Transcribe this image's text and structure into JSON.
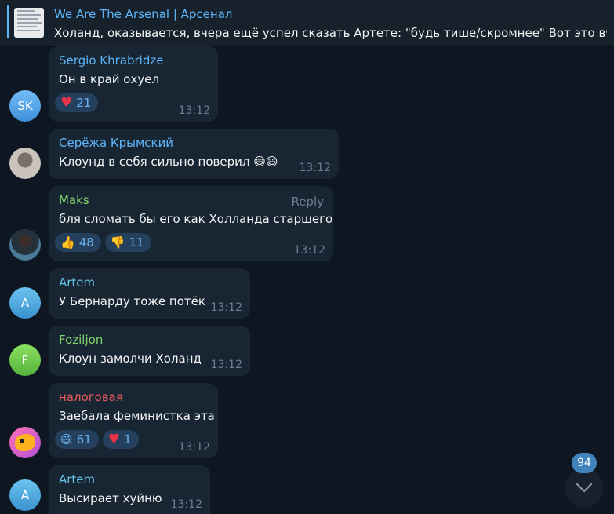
{
  "pinned": {
    "title": "We Are The Arsenal | Арсенал",
    "text": "Холанд, оказывается, вчера ещё успел сказать Артете: \"будь тише/скромнее\"  Вот это вч..."
  },
  "messages": [
    {
      "avatar_initials": "SK",
      "name": "Sergio Khrabridze",
      "name_color": "#5eb5f7",
      "text": "Он в край охуел",
      "time": "13:12",
      "reactions": [
        {
          "emoji": "heart",
          "count": "21"
        }
      ]
    },
    {
      "avatar_initials": "",
      "name": "Серёжа Крымский",
      "name_color": "#5eb5f7",
      "text": "Клоунд в себя сильно поверил 😄😄",
      "time": "13:12",
      "reactions": []
    },
    {
      "avatar_initials": "",
      "name": "Maks",
      "name_color": "#7fd66a",
      "reply": "Reply",
      "text": "бля сломать бы его как Холланда старшего",
      "time": "13:12",
      "reactions": [
        {
          "emoji": "👍",
          "count": "48"
        },
        {
          "emoji": "👎",
          "count": "11"
        }
      ]
    },
    {
      "avatar_initials": "A",
      "name": "Artem",
      "name_color": "#65c6e8",
      "text": "У Бернарду тоже потёк",
      "time": "13:12",
      "reactions": []
    },
    {
      "avatar_initials": "F",
      "name": "Foziljon",
      "name_color": "#7fd66a",
      "text": "Клоун замолчи Холанд",
      "time": "13:12",
      "reactions": []
    },
    {
      "avatar_initials": "",
      "name": "налоговая",
      "name_color": "#e65b5b",
      "text": "Заебала феминистка эта",
      "time": "13:12",
      "reactions": [
        {
          "emoji": "😄",
          "count": "61"
        },
        {
          "emoji": "heart",
          "count": "1"
        }
      ]
    },
    {
      "avatar_initials": "A",
      "name": "Artem",
      "name_color": "#65c6e8",
      "text": "Высирает хуйню",
      "time": "13:12",
      "reactions": []
    }
  ],
  "scroll_down": {
    "unread_count": "94"
  }
}
